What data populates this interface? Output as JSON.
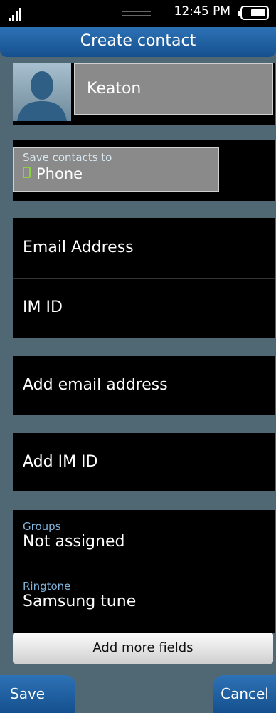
{
  "status": {
    "time": "12:45 PM"
  },
  "title": "Create contact",
  "contact": {
    "name": "Keaton"
  },
  "save_to": {
    "label": "Save contacts to",
    "value": "Phone"
  },
  "fields": {
    "email_label": "Email Address",
    "im_label": "IM ID"
  },
  "add_email": "Add email address",
  "add_im": "Add IM ID",
  "groups": {
    "label": "Groups",
    "value": "Not assigned"
  },
  "ringtone": {
    "label": "Ringtone",
    "value": "Samsung tune"
  },
  "add_more_fields": "Add more fields",
  "buttons": {
    "save": "Save",
    "cancel": "Cancel"
  },
  "colors": {
    "background": "#4f6874",
    "accent": "#1e5fa3",
    "label_blue": "#80b4dc"
  },
  "icons": [
    "signal-icon",
    "battery-icon",
    "contact-avatar-icon",
    "phone-icon"
  ]
}
